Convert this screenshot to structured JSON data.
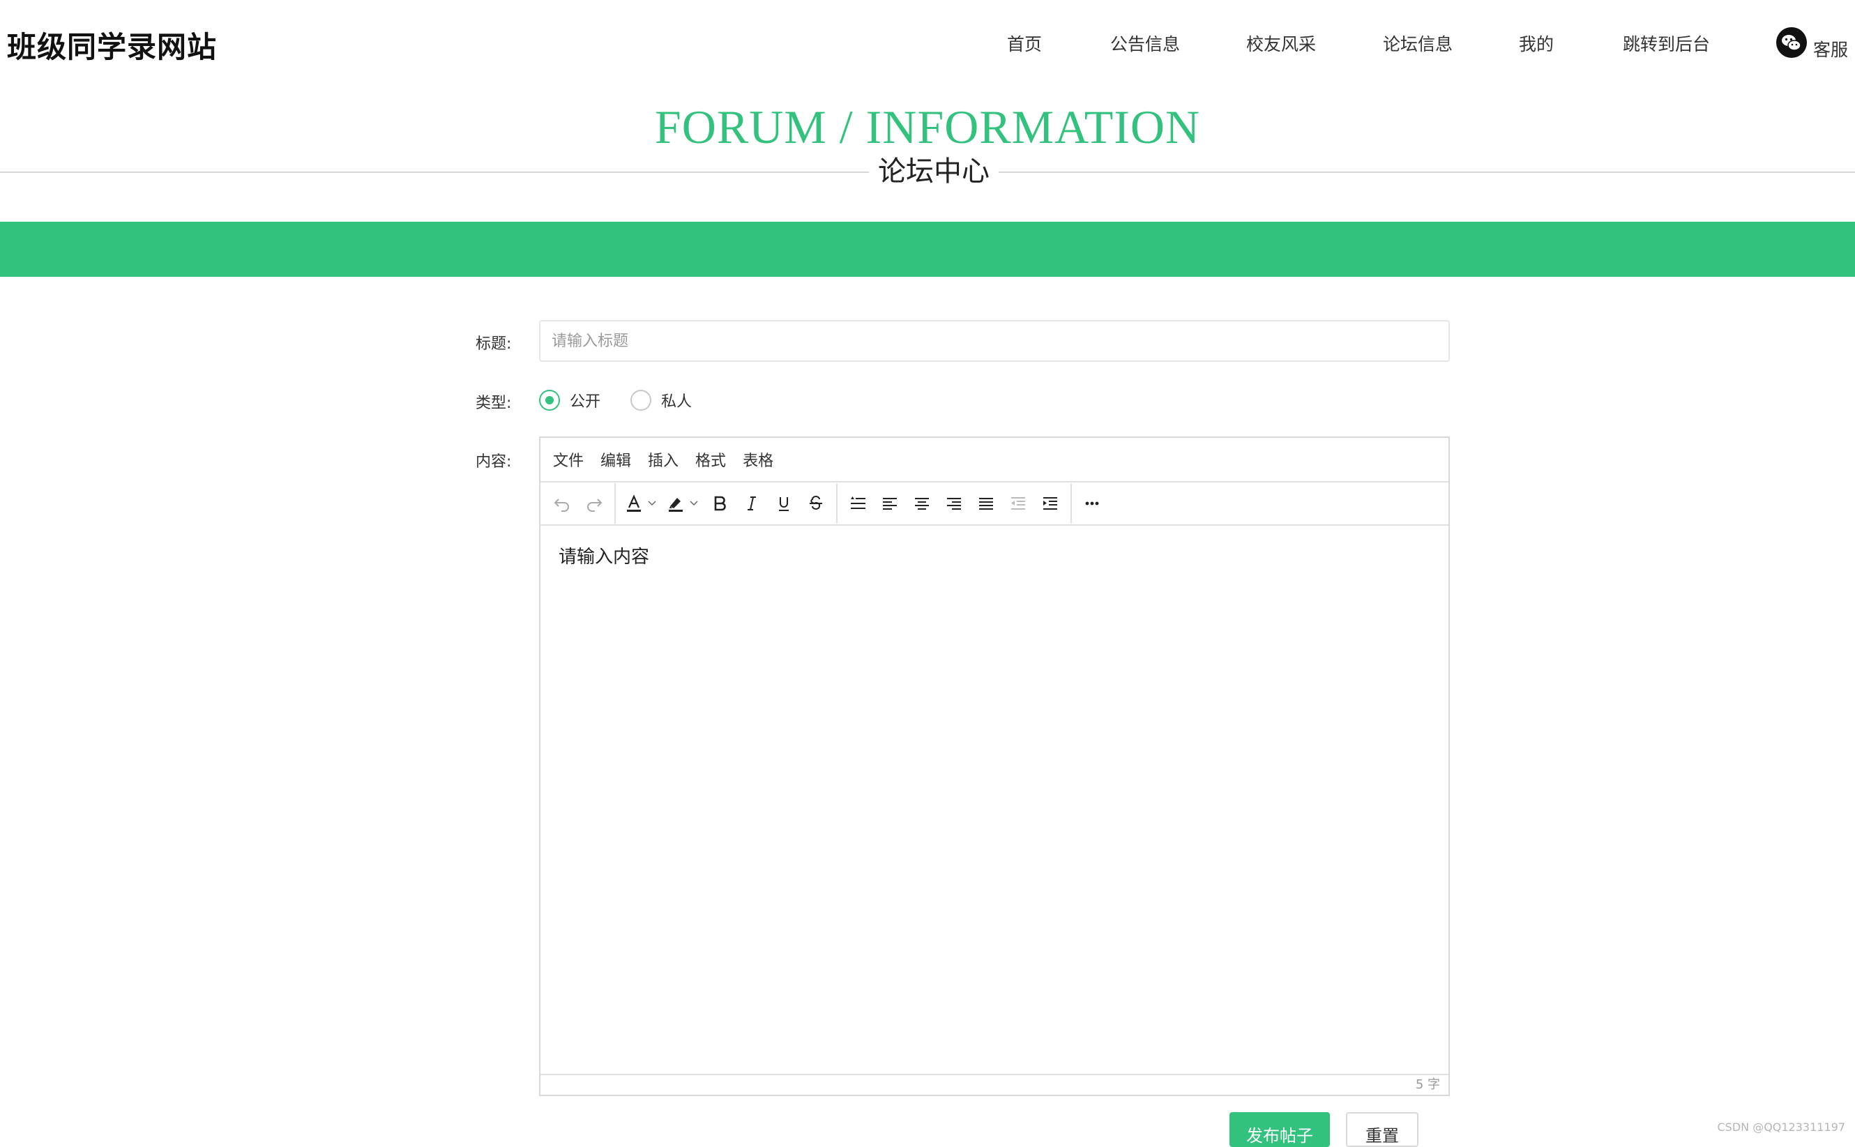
{
  "header": {
    "site_title": "班级同学录网站",
    "nav": [
      "首页",
      "公告信息",
      "校友风采",
      "论坛信息",
      "我的",
      "跳转到后台"
    ],
    "support_label": "客服"
  },
  "hero": {
    "title_en": "FORUM / INFORMATION",
    "title_cn": "论坛中心"
  },
  "form": {
    "title_label": "标题:",
    "title_placeholder": "请输入标题",
    "title_value": "",
    "type_label": "类型:",
    "type_options": [
      {
        "label": "公开",
        "selected": true
      },
      {
        "label": "私人",
        "selected": false
      }
    ],
    "content_label": "内容:"
  },
  "editor": {
    "menu": [
      "文件",
      "编辑",
      "插入",
      "格式",
      "表格"
    ],
    "toolbar_icons": [
      "undo-icon",
      "redo-icon",
      "text-color-icon",
      "highlight-color-icon",
      "bold-icon",
      "italic-icon",
      "underline-icon",
      "strikethrough-icon",
      "line-height-icon",
      "align-left-icon",
      "align-center-icon",
      "align-right-icon",
      "align-justify-icon",
      "outdent-icon",
      "indent-icon",
      "more-icon"
    ],
    "content": "请输入内容",
    "word_count": "5 字"
  },
  "actions": {
    "submit_label": "发布帖子",
    "reset_label": "重置"
  },
  "watermark": "CSDN @QQ123311197",
  "colors": {
    "accent": "#33c27d",
    "text": "#333333",
    "border": "#d9d9d9"
  }
}
